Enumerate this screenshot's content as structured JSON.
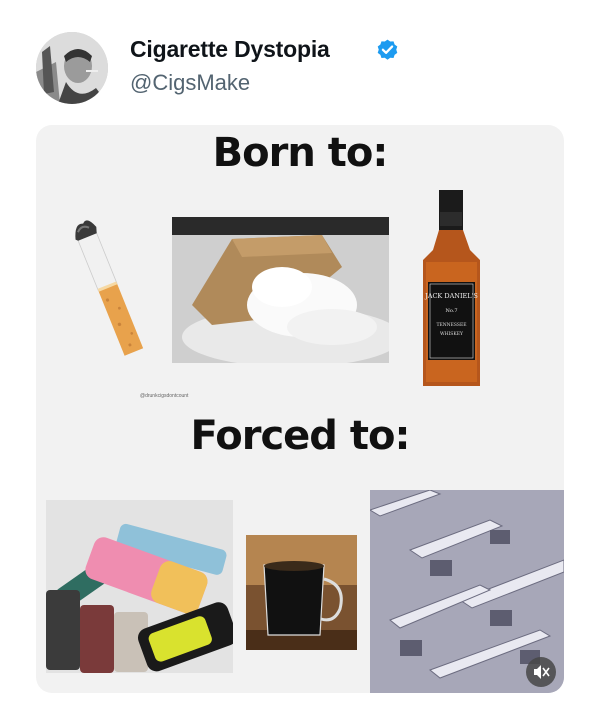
{
  "tweet": {
    "display_name": "Cigarette Dystopia",
    "handle": "@CigsMake",
    "verified": true,
    "verified_color": "#1d9bf0",
    "avatar_icon": "profile-photo"
  },
  "media": {
    "top_caption": "Born to:",
    "bottom_caption": "Forced to:",
    "watermark": "@drunkcigsdontcount",
    "born_items": [
      "cigarette-image",
      "flour-bag-image",
      "whiskey-bottle-image"
    ],
    "forced_items": [
      "vapes-image",
      "coffee-mug-image",
      "office-cubicles-image"
    ],
    "bottle_label": {
      "brand": "JACK DANIEL'S",
      "number": "No.7",
      "line1": "TENNESSEE",
      "line2": "WHISKEY"
    },
    "mute_icon": "volume-mute-icon"
  }
}
